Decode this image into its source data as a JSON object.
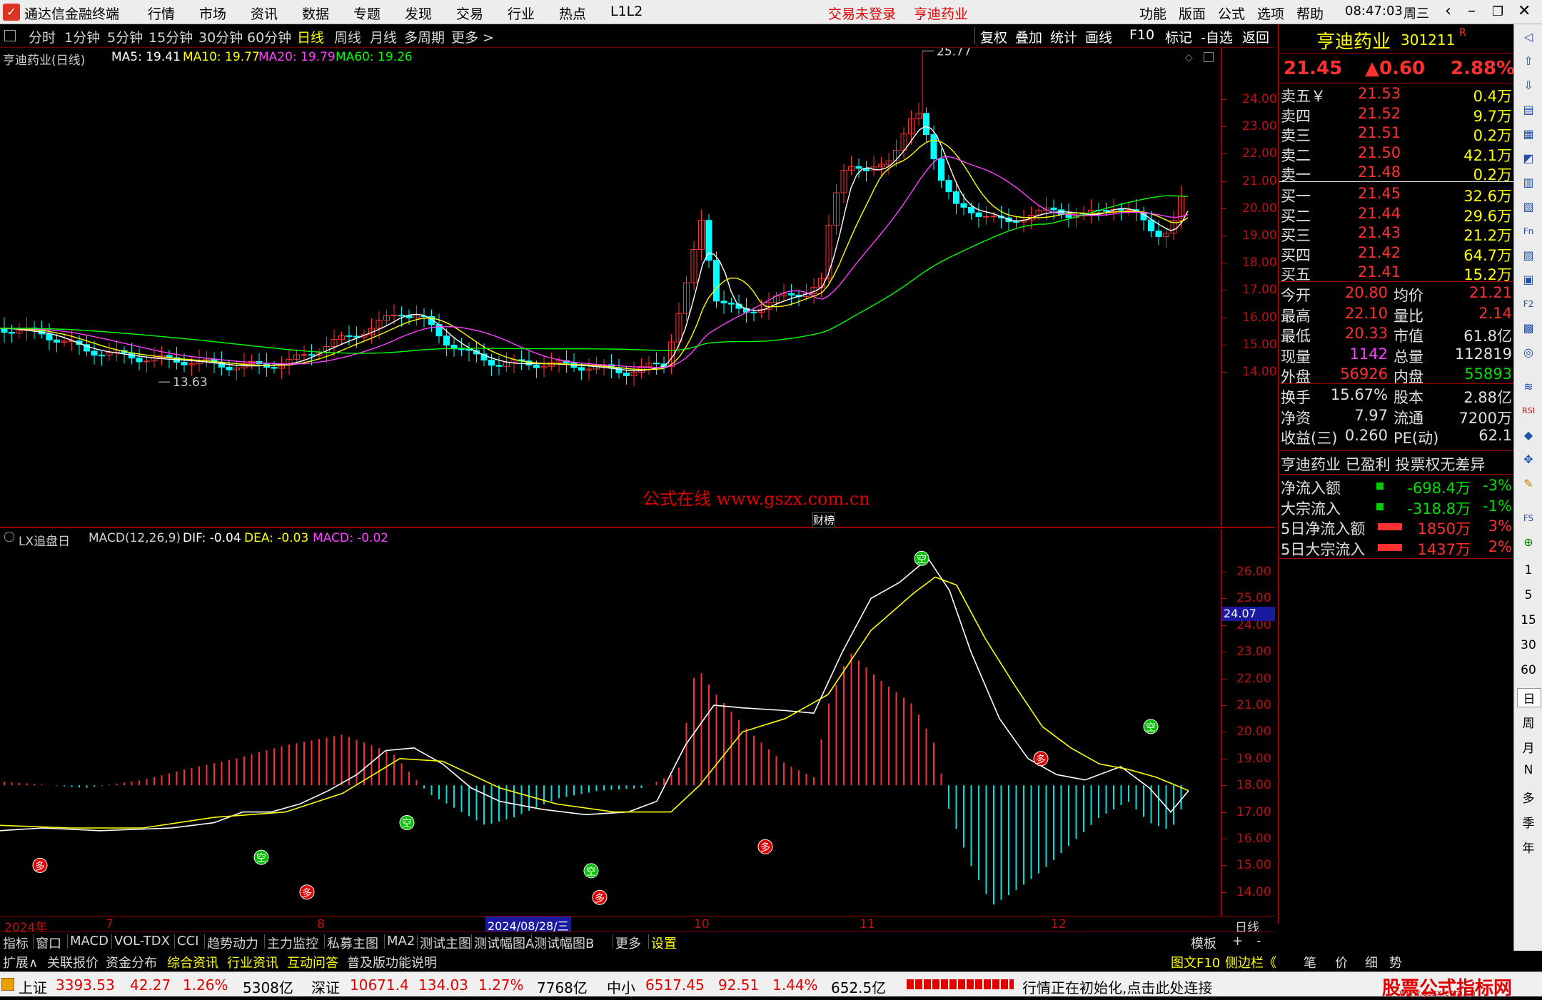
{
  "menubar": {
    "app_title": "通达信金融终端",
    "items": [
      "行情",
      "市场",
      "资讯",
      "数据",
      "专题",
      "发现",
      "交易",
      "行业",
      "热点",
      "L1L2"
    ],
    "notice_login": "交易未登录",
    "notice_stock": "亨迪药业",
    "right_items": [
      "功能",
      "版面",
      "公式",
      "选项",
      "帮助"
    ],
    "time": "08:47:03",
    "weekday": "周三"
  },
  "periodbar": {
    "periods": [
      "分时",
      "1分钟",
      "5分钟",
      "15分钟",
      "30分钟",
      "60分钟",
      "日线",
      "周线",
      "月线",
      "多周期",
      "更多 >"
    ],
    "active": "日线",
    "tools": [
      "复权",
      "叠加",
      "统计",
      "画线",
      "F10",
      "标记",
      "-自选",
      "返回"
    ]
  },
  "mainchart": {
    "title": "亨迪药业(日线)",
    "ma_labels": [
      {
        "text": "MA5: 19.41",
        "color": "#ffffff"
      },
      {
        "text": "MA10: 19.77",
        "color": "#ffff00"
      },
      {
        "text": "MA20: 19.79",
        "color": "#ff40ff"
      },
      {
        "text": "MA60: 19.26",
        "color": "#00ff00"
      }
    ],
    "high_label": "25.77",
    "low_label": "13.63",
    "watermark": "公式在线  www.gszx.com.cn",
    "event_label": "财榜",
    "yticks": [
      "24.00",
      "23.00",
      "22.00",
      "21.00",
      "20.00",
      "19.00",
      "18.00",
      "17.00",
      "16.00",
      "15.00",
      "14.00"
    ]
  },
  "subchart": {
    "title": "LX追盘日",
    "indicator": "MACD(12,26,9)",
    "dif": "DIF: -0.04",
    "dea": "DEA: -0.03",
    "macd": "MACD: -0.02",
    "yticks": [
      "26.00",
      "25.00",
      "24.00",
      "23.00",
      "22.00",
      "21.00",
      "20.00",
      "19.00",
      "18.00",
      "17.00",
      "16.00",
      "15.00",
      "14.00"
    ],
    "cursor_value": "24.07",
    "signal_kong": "空",
    "signal_duo": "多"
  },
  "dateaxis": {
    "labels": [
      "2024年",
      "7",
      "8",
      "2024/08/28/三",
      "10",
      "11",
      "12"
    ],
    "period": "日线"
  },
  "quote": {
    "name": "亨迪药业",
    "code": "301211",
    "flag": "R",
    "price": "21.45",
    "change": "▲0.60",
    "pct": "2.88%",
    "asks": [
      {
        "label": "卖五￥",
        "price": "21.53",
        "vol": "0.4万"
      },
      {
        "label": "卖四",
        "price": "21.52",
        "vol": "9.7万"
      },
      {
        "label": "卖三",
        "price": "21.51",
        "vol": "0.2万"
      },
      {
        "label": "卖二",
        "price": "21.50",
        "vol": "42.1万"
      },
      {
        "label": "卖一",
        "price": "21.48",
        "vol": "0.2万"
      }
    ],
    "bids": [
      {
        "label": "买一",
        "price": "21.45",
        "vol": "32.6万"
      },
      {
        "label": "买二",
        "price": "21.44",
        "vol": "29.6万"
      },
      {
        "label": "买三",
        "price": "21.43",
        "vol": "21.2万"
      },
      {
        "label": "买四",
        "price": "21.42",
        "vol": "64.7万"
      },
      {
        "label": "买五",
        "price": "21.41",
        "vol": "15.2万"
      }
    ],
    "stats1": [
      {
        "l1": "今开",
        "v1": "20.80",
        "c1": "red",
        "l2": "均价",
        "v2": "21.21",
        "c2": "red"
      },
      {
        "l1": "最高",
        "v1": "22.10",
        "c1": "red",
        "l2": "量比",
        "v2": "2.14",
        "c2": "red"
      },
      {
        "l1": "最低",
        "v1": "20.33",
        "c1": "red",
        "l2": "市值",
        "v2": "61.8亿",
        "c2": "white"
      },
      {
        "l1": "现量",
        "v1": "1142",
        "c1": "magenta",
        "l2": "总量",
        "v2": "112819",
        "c2": "white"
      },
      {
        "l1": "外盘",
        "v1": "56926",
        "c1": "red",
        "l2": "内盘",
        "v2": "55893",
        "c2": "green"
      }
    ],
    "stats2": [
      {
        "l1": "换手",
        "v1": "15.67%",
        "c1": "white",
        "l2": "股本",
        "v2": "2.88亿",
        "c2": "white"
      },
      {
        "l1": "净资",
        "v1": "7.97",
        "c1": "white",
        "l2": "流通",
        "v2": "7200万",
        "c2": "white"
      },
      {
        "l1": "收益(三)",
        "v1": "0.260",
        "c1": "white",
        "l2": "PE(动)",
        "v2": "62.1",
        "c2": "white"
      }
    ],
    "info_line": "亨迪药业 已盈利 投票权无差异",
    "flows": [
      {
        "label": "净流入额",
        "value": "-698.4万",
        "pct": "-3%",
        "color": "green"
      },
      {
        "label": "大宗流入",
        "value": "-318.8万",
        "pct": "-1%",
        "color": "green"
      },
      {
        "label": "5日净流入额",
        "value": "1850万",
        "pct": "3%",
        "color": "red"
      },
      {
        "label": "5日大宗流入",
        "value": "1437万",
        "pct": "2%",
        "color": "red"
      }
    ]
  },
  "sidebar": {
    "texts": [
      "1",
      "5",
      "15",
      "30",
      "60",
      "日",
      "周",
      "月",
      "N",
      "多",
      "季",
      "年"
    ]
  },
  "tabbar1": {
    "tabs": [
      "指标",
      "窗口",
      "MACD",
      "VOL-TDX",
      "CCI",
      "趋势动力",
      "主力监控",
      "私募主图",
      "MA2",
      "测试主图",
      "测试幅图A",
      "测试幅图B",
      "更多",
      "设置"
    ],
    "right": [
      "模板",
      "+",
      "-"
    ]
  },
  "tabbar2": {
    "tabs": [
      "扩展∧",
      "关联报价",
      "资金分布",
      "综合资讯",
      "行业资讯",
      "互动问答",
      "普及版功能说明"
    ],
    "right": [
      "图文F10",
      "侧边栏《",
      "笔",
      "价",
      "细",
      "势"
    ]
  },
  "statusbar": {
    "items": [
      {
        "name": "上证",
        "value": "3393.53",
        "chg": "42.27",
        "pct": "1.26%",
        "amt": "5308亿"
      },
      {
        "name": "深证",
        "value": "10671.4",
        "chg": "134.03",
        "pct": "1.27%",
        "amt": "7768亿"
      },
      {
        "name": "中小",
        "value": "6517.45",
        "chg": "92.51",
        "pct": "1.44%",
        "amt": "652.5亿"
      }
    ],
    "message": "行情正在初始化,点击此处连接",
    "brand": "股票公式指标网",
    "brand_url": "www.gszx.com.cn"
  }
}
